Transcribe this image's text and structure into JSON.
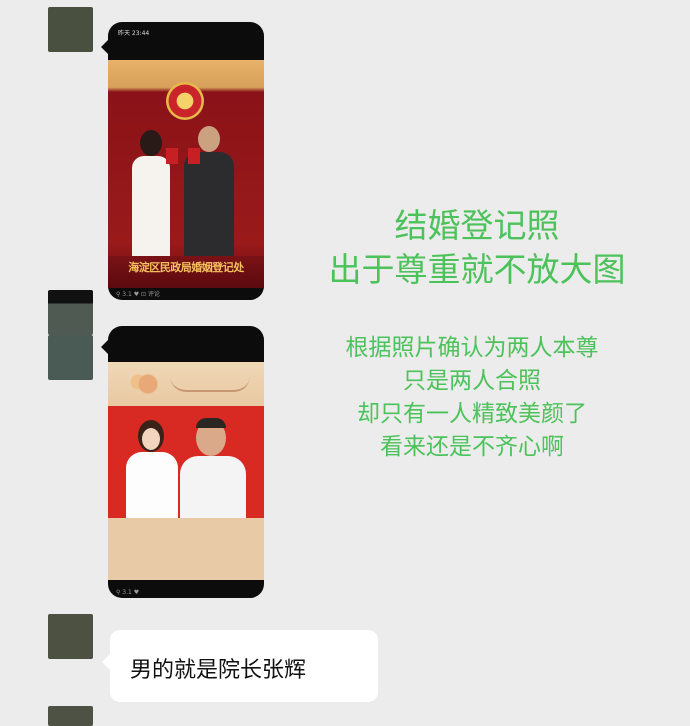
{
  "messages": [
    {
      "type": "image",
      "status_time": "昨天 23:44",
      "sign_text": "海淀区民政局婚姻登记处",
      "meta_text": "⚲ 3.1 ♥ ⊡ 评论"
    },
    {
      "type": "image",
      "meta_text": "⚲ 3.1 ♥"
    },
    {
      "type": "text",
      "text": "男的就是院长张辉"
    }
  ],
  "caption": {
    "title_lines": [
      "结婚登记照",
      "出于尊重就不放大图"
    ],
    "body_lines": [
      "根据照片确认为两人本尊",
      "只是两人合照",
      "却只有一人精致美颜了",
      "看来还是不齐心啊"
    ],
    "color": "#4cc25a"
  }
}
